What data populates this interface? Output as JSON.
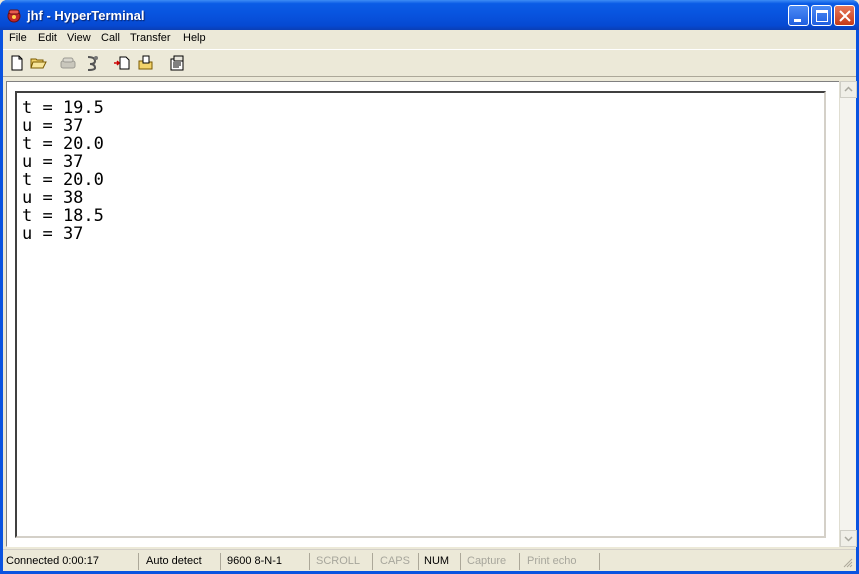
{
  "window": {
    "title": "jhf - HyperTerminal",
    "icon": "hyperterminal-phone-icon",
    "controls": [
      "minimize-icon",
      "maximize-icon",
      "close-icon"
    ]
  },
  "menu": {
    "items": [
      "File",
      "Edit",
      "View",
      "Call",
      "Transfer",
      "Help"
    ]
  },
  "toolbar": {
    "icons": [
      "new-document-icon",
      "open-folder-icon",
      "disconnected-phone-icon",
      "hang-up-icon",
      "send-file-icon",
      "receive-file-icon",
      "properties-icon"
    ]
  },
  "terminal": {
    "lines": [
      "t = 19.5",
      "u = 37",
      "t = 20.0",
      "u = 37",
      "t = 20.0",
      "u = 38",
      "t = 18.5",
      "u = 37"
    ]
  },
  "status": {
    "connected": "Connected 0:00:17",
    "detect": "Auto detect",
    "settings": "9600 8-N-1",
    "scroll": "SCROLL",
    "caps": "CAPS",
    "num": "NUM",
    "capture": "Capture",
    "print_echo": "Print echo"
  },
  "colors": {
    "titlebar": "#0853de",
    "close_button": "#c63a17",
    "window_face": "#ece9d8",
    "status_disabled_text": "#a7a69c"
  }
}
